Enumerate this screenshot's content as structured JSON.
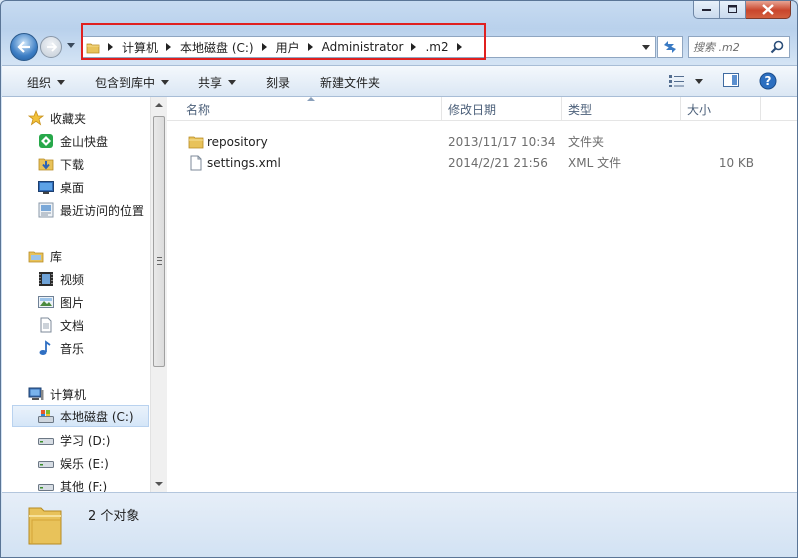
{
  "address": {
    "crumbs": [
      "计算机",
      "本地磁盘 (C:)",
      "用户",
      "Administrator",
      ".m2"
    ]
  },
  "search": {
    "placeholder": "搜索 .m2"
  },
  "toolbar": {
    "organize": "组织",
    "include_library": "包含到库中",
    "share": "共享",
    "burn": "刻录",
    "new_folder": "新建文件夹"
  },
  "sidebar": {
    "favorites": {
      "label": "收藏夹",
      "items": [
        "金山快盘",
        "下载",
        "桌面",
        "最近访问的位置"
      ]
    },
    "libraries": {
      "label": "库",
      "items": [
        "视频",
        "图片",
        "文档",
        "音乐"
      ]
    },
    "computer": {
      "label": "计算机",
      "items": [
        "本地磁盘 (C:)",
        "学习 (D:)",
        "娱乐 (E:)",
        "其他 (F:)"
      ]
    }
  },
  "columns": {
    "name": "名称",
    "date": "修改日期",
    "type": "类型",
    "size": "大小"
  },
  "files": [
    {
      "name": "repository",
      "date": "2013/11/17 10:34",
      "type": "文件夹",
      "size": ""
    },
    {
      "name": "settings.xml",
      "date": "2014/2/21 21:56",
      "type": "XML 文件",
      "size": "10 KB"
    }
  ],
  "status": {
    "count_text": "2 个对象"
  },
  "colors": {
    "highlight_box": "#e0201f",
    "folder": "#e8c25a",
    "selected_bg": "#d5e6f8"
  }
}
